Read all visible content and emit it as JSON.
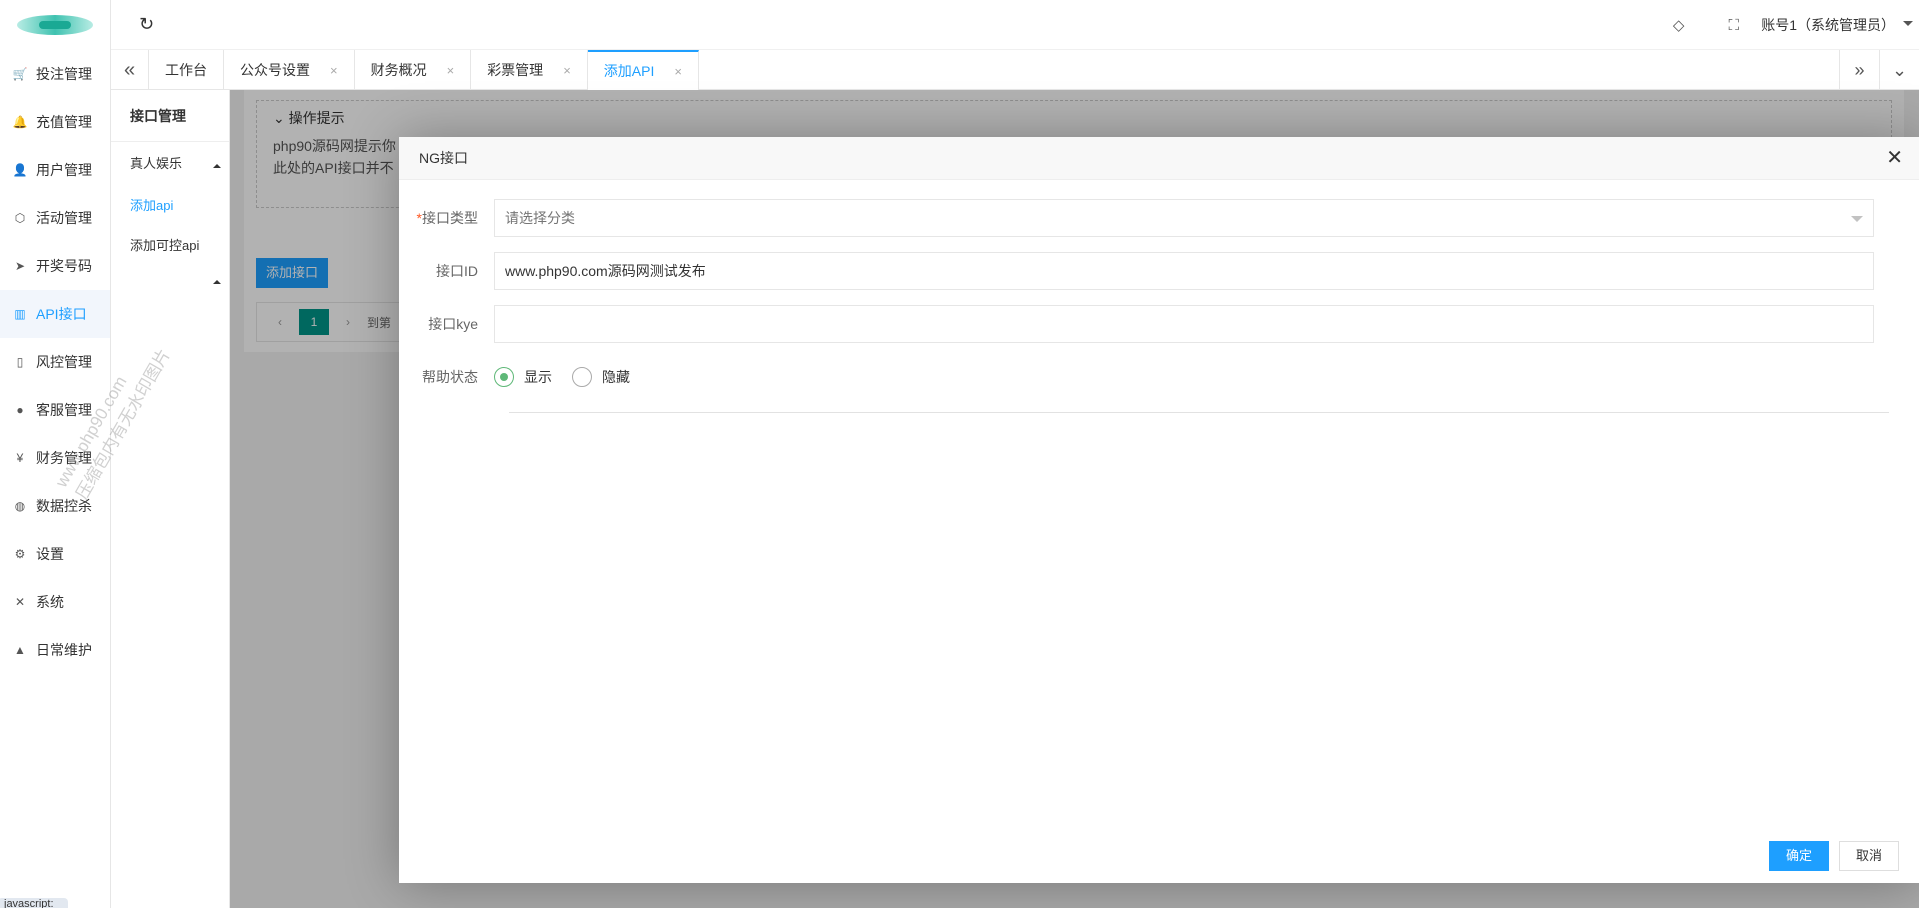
{
  "sidebar": {
    "items": [
      {
        "label": "投注管理",
        "icon": "cart-icon",
        "glyph": "🛒"
      },
      {
        "label": "充值管理",
        "icon": "bell-icon",
        "glyph": "🔔"
      },
      {
        "label": "用户管理",
        "icon": "user-icon",
        "glyph": "👤"
      },
      {
        "label": "活动管理",
        "icon": "cube-icon",
        "glyph": "⬡"
      },
      {
        "label": "开奖号码",
        "icon": "send-icon",
        "glyph": "➤"
      },
      {
        "label": "API接口",
        "icon": "book-icon",
        "glyph": "▥"
      },
      {
        "label": "风控管理",
        "icon": "phone-icon",
        "glyph": "▯"
      },
      {
        "label": "客服管理",
        "icon": "chat-icon",
        "glyph": "●"
      },
      {
        "label": "财务管理",
        "icon": "yen-icon",
        "glyph": "¥"
      },
      {
        "label": "数据控杀",
        "icon": "globe-icon",
        "glyph": "◍"
      },
      {
        "label": "设置",
        "icon": "gear-icon",
        "glyph": "⚙"
      },
      {
        "label": "系统",
        "icon": "tools-icon",
        "glyph": "✕"
      },
      {
        "label": "日常维护",
        "icon": "person-icon",
        "glyph": "▲"
      }
    ],
    "active_index": 5,
    "bottom_badge": "javascript:"
  },
  "topbar": {
    "refresh_glyph": "↻",
    "tag_glyph": "◇",
    "fullscreen_glyph": "⛶",
    "user": "账号1（系统管理员）"
  },
  "tabs": {
    "left_glyph": "«",
    "items": [
      {
        "label": "工作台",
        "closable": false
      },
      {
        "label": "公众号设置",
        "closable": true
      },
      {
        "label": "财务概况",
        "closable": true
      },
      {
        "label": "彩票管理",
        "closable": true
      },
      {
        "label": "添加API",
        "closable": true,
        "active": true
      }
    ],
    "close_glyph": "×",
    "right_glyph": "»",
    "dropdown_glyph": "⌄"
  },
  "subnav": {
    "title": "接口管理",
    "group": "真人娱乐",
    "items": [
      {
        "label": "添加api",
        "active": true
      },
      {
        "label": "添加可控api",
        "active": false
      }
    ]
  },
  "page": {
    "tips_title": "操作提示",
    "tips_line1": "php90源码网提示你",
    "tips_line2": "此处的API接口并不",
    "add_button": "添加接口",
    "pager_current": "1",
    "pager_goto": "到第"
  },
  "watermark": {
    "line1": "www.php90.com",
    "line2": "压缩包内有无水印图片"
  },
  "modal": {
    "title": "NG接口",
    "close_glyph": "✕",
    "fields": {
      "type_label": "接口类型",
      "type_required": "*",
      "type_placeholder": "请选择分类",
      "id_label": "接口ID",
      "id_value": "www.php90.com源码网测试发布",
      "kye_label": "接口kye",
      "kye_value": "",
      "status_label": "帮助状态",
      "status_options": [
        "显示",
        "隐藏"
      ],
      "status_selected": "显示"
    },
    "confirm": "确定",
    "cancel": "取消"
  },
  "colors": {
    "accent": "#1e9fff",
    "pager_active": "#009688",
    "radio_on": "#5fb878"
  }
}
